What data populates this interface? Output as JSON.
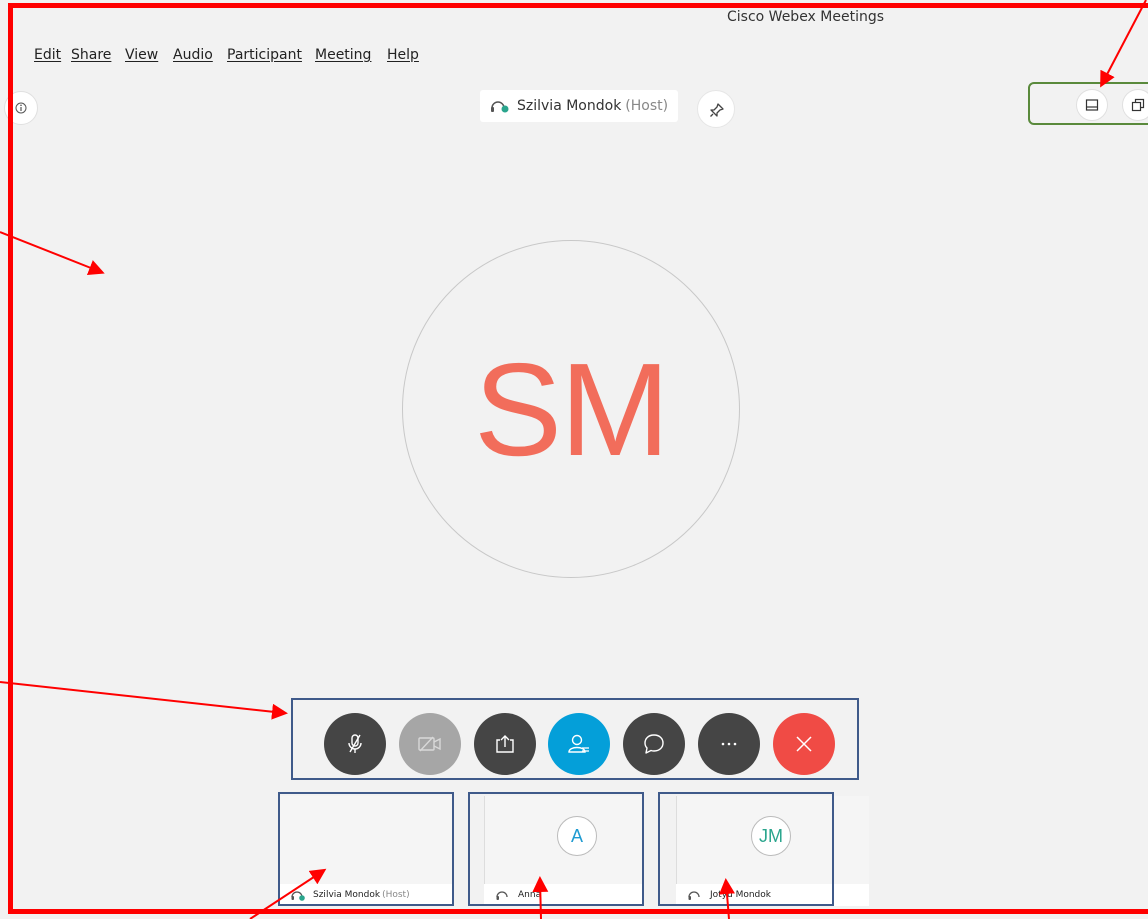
{
  "window": {
    "title": "Cisco Webex Meetings"
  },
  "menu": {
    "items": [
      {
        "label": "Edit"
      },
      {
        "label": "Share"
      },
      {
        "label": "View"
      },
      {
        "label": "Audio"
      },
      {
        "label": "Participant"
      },
      {
        "label": "Meeting"
      },
      {
        "label": "Help"
      }
    ]
  },
  "active_speaker": {
    "name": "Szilvia Mondok",
    "role": "(Host)",
    "initials": "SM",
    "initials_color": "#f26d5b"
  },
  "controls": [
    {
      "name": "mute",
      "icon": "microphone-muted-icon",
      "state": "on"
    },
    {
      "name": "video",
      "icon": "video-off-icon",
      "state": "disabled"
    },
    {
      "name": "share",
      "icon": "share-icon",
      "state": "on"
    },
    {
      "name": "participants",
      "icon": "participants-icon",
      "state": "active"
    },
    {
      "name": "chat",
      "icon": "chat-icon",
      "state": "on"
    },
    {
      "name": "more",
      "icon": "more-icon",
      "state": "on"
    },
    {
      "name": "leave",
      "icon": "close-icon",
      "state": "on"
    }
  ],
  "participants": [
    {
      "name": "Szilvia Mondok",
      "role": "(Host)",
      "initials": ""
    },
    {
      "name": "Anna",
      "role": "",
      "initials": "A"
    },
    {
      "name": "Jotyu Mondok",
      "role": "",
      "initials": "JM"
    }
  ],
  "colors": {
    "accent_blue": "#049fd9",
    "leave_red": "#f04b45",
    "annotation_red": "#ff0000",
    "annotation_blue": "#3f5a8a",
    "annotation_green": "#5a8a3c"
  }
}
